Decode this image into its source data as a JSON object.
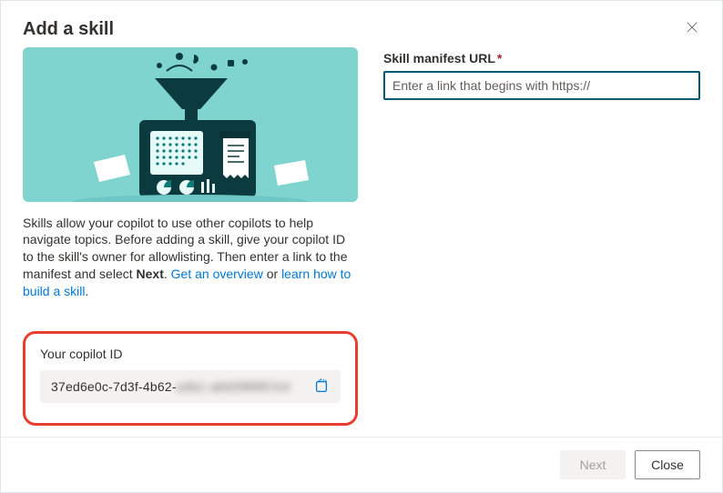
{
  "dialog": {
    "title": "Add a skill"
  },
  "intro": {
    "text1": "Skills allow your copilot to use other copilots to help navigate topics. Before adding a skill, give your copilot ID to the skill's owner for allowlisting. Then enter a link to the manifest and select ",
    "nextWord": "Next",
    "period": ". ",
    "link1": "Get an overview",
    "or": " or ",
    "link2": "learn how to build a skill",
    "endPeriod": "."
  },
  "copilot": {
    "label": "Your copilot ID",
    "idPrefix": "37ed6e0c-7d3f-4b62-",
    "idSuffix": "a3b1-a8d39f6f87e4"
  },
  "form": {
    "manifestLabel": "Skill manifest URL",
    "manifestPlaceholder": "Enter a link that begins with https://",
    "manifestValue": ""
  },
  "footer": {
    "next": "Next",
    "close": "Close"
  }
}
